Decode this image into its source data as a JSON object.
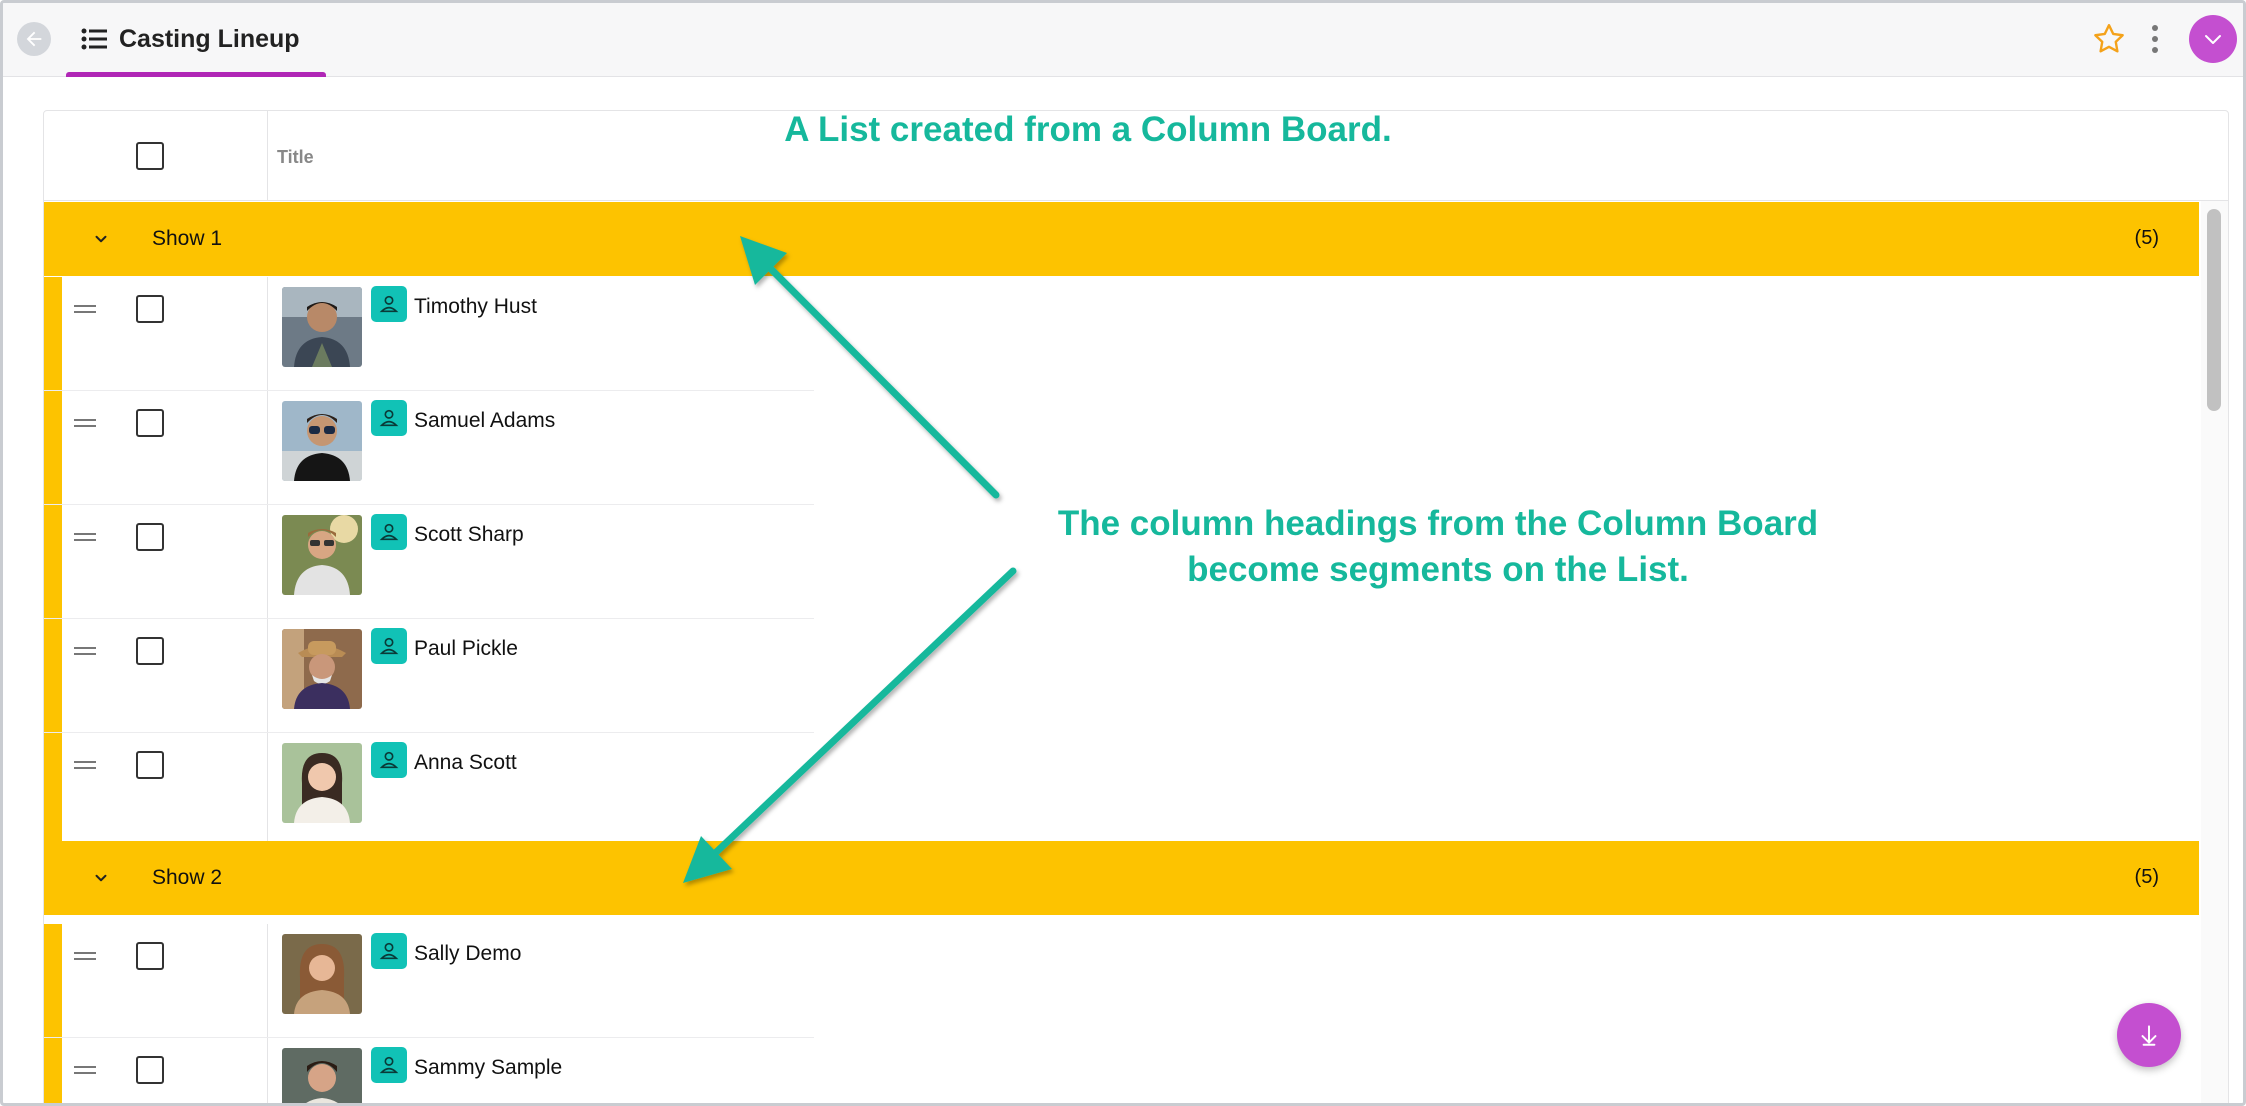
{
  "header": {
    "title": "Casting Lineup",
    "list_icon": "list-icon",
    "back_icon": "arrow-left-icon",
    "star_icon": "star-outline-icon",
    "more_icon": "more-vertical-icon",
    "profile_icon": "chevron-down-icon"
  },
  "table": {
    "column_title": "Title",
    "segments": [
      {
        "label": "Show 1",
        "count": "(5)",
        "rows": [
          {
            "name": "Timothy Hust"
          },
          {
            "name": "Samuel Adams"
          },
          {
            "name": "Scott Sharp"
          },
          {
            "name": "Paul Pickle"
          },
          {
            "name": "Anna Scott"
          }
        ]
      },
      {
        "label": "Show 2",
        "count": "(5)",
        "rows": [
          {
            "name": "Sally Demo"
          },
          {
            "name": "Sammy Sample"
          }
        ]
      }
    ]
  },
  "annotations": {
    "top": "A List created from a Column Board.",
    "middle_line1": "The column headings from the Column Board",
    "middle_line2": "become segments on the List."
  },
  "colors": {
    "segment": "#fdc300",
    "accent": "#c44fd0",
    "annotation": "#16b89c",
    "person_badge": "#11c2b6",
    "underline": "#b026b6"
  },
  "fab_icon": "arrow-down-icon"
}
